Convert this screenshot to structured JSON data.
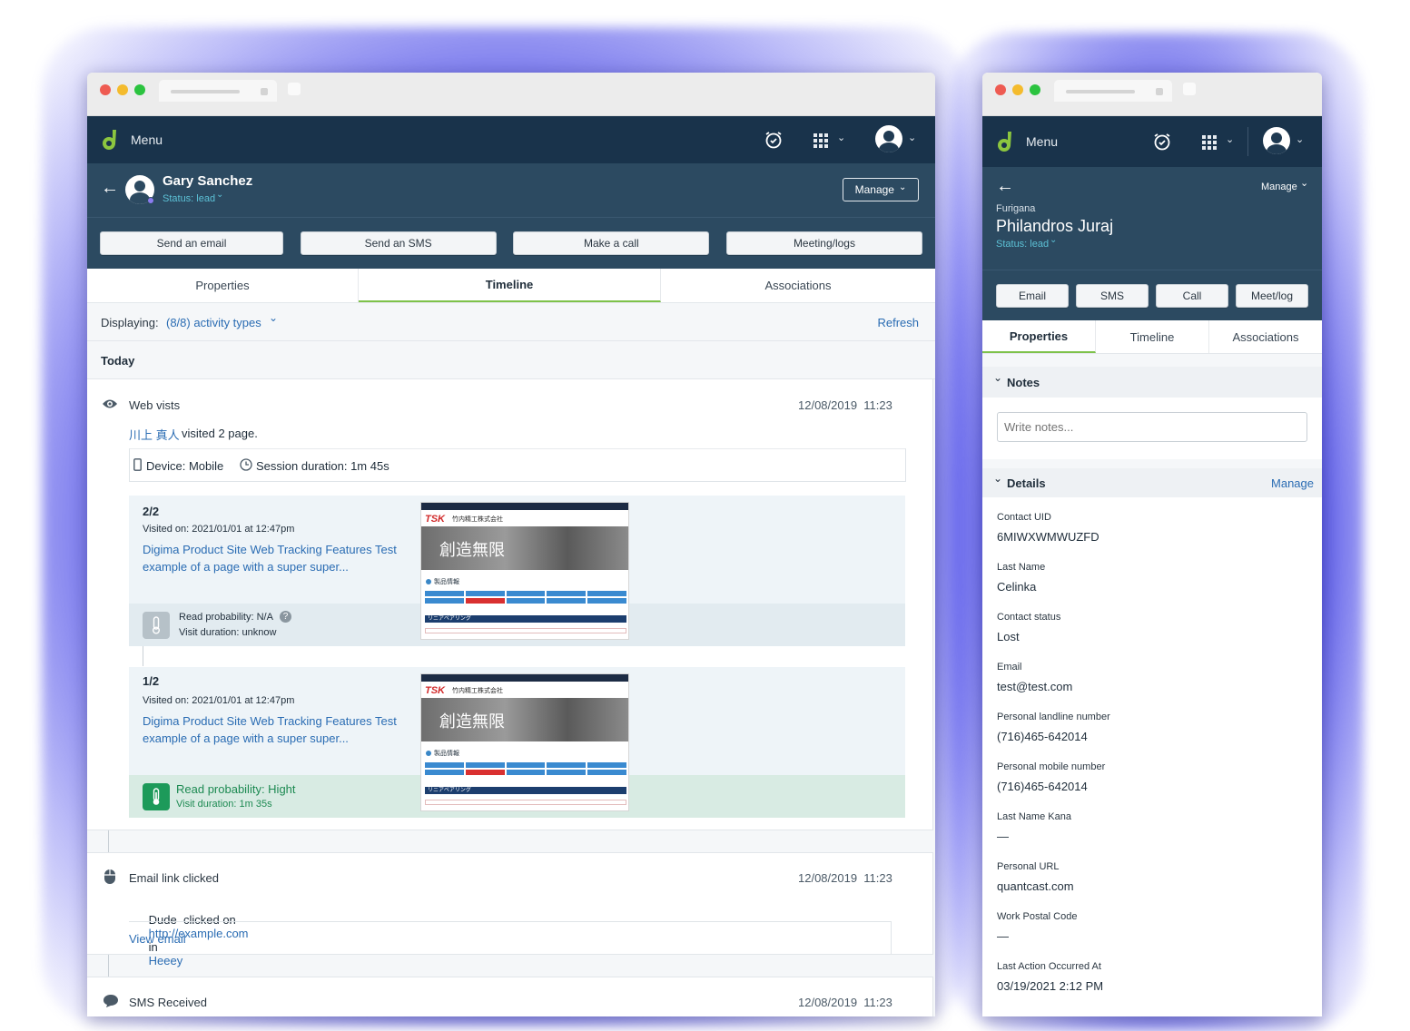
{
  "left_window": {
    "nav": {
      "menu_label": "Menu"
    },
    "contact": {
      "name": "Gary Sanchez",
      "status": "Status: lead",
      "manage_label": "Manage"
    },
    "actions": [
      "Send an email",
      "Send an SMS",
      "Make a call",
      "Meeting/logs"
    ],
    "tabs": [
      "Properties",
      "Timeline",
      "Associations"
    ],
    "active_tab": "Timeline",
    "filter": {
      "displaying_label": "Displaying:",
      "value": "(8/8) activity types",
      "refresh_label": "Refresh"
    },
    "section_today": "Today",
    "web_visits": {
      "title": "Web vists",
      "timestamp": "12/08/2019  11:23",
      "visitor_name": "川上 真人",
      "visitor_text": "visited 2 page.",
      "device": "Device: Mobile",
      "session": "Session duration: 1m 45s",
      "pages": [
        {
          "index": "2/2",
          "visited_on": "Visited on: 2021/01/01 at 12:47pm",
          "title_line1": "Digima Product Site Web Tracking Features Test",
          "title_line2": "example of a page with a super super...",
          "read_probability": "Read probability: N/A",
          "visit_duration": "Visit duration: unknow"
        },
        {
          "index": "1/2",
          "visited_on": "Visited on: 2021/01/01 at 12:47pm",
          "title_line1": "Digima Product Site Web Tracking Features Test",
          "title_line2": "example of a page with a super super...",
          "read_probability": "Read probability: Hight",
          "visit_duration": "Visit duration: 1m 35s"
        }
      ],
      "thumbnail": {
        "brand": "TSK",
        "company": "竹内精工株式会社",
        "banner": "創造無限",
        "section": "製品情報",
        "subsection": "リニアベアリング"
      }
    },
    "email_click": {
      "title": "Email link clicked",
      "timestamp": "12/08/2019  11:23",
      "who": "Dude  clicked on",
      "url": "http://example.com",
      "in_word": "in",
      "campaign": "Heeey",
      "view_label": "View email"
    },
    "sms": {
      "title": "SMS Received",
      "timestamp": "12/08/2019  11:23"
    }
  },
  "right_window": {
    "nav": {
      "menu_label": "Menu"
    },
    "contact": {
      "furigana_label": "Furigana",
      "name": "Philandros Juraj",
      "status": "Status: lead",
      "manage_label": "Manage"
    },
    "actions": [
      "Email",
      "SMS",
      "Call",
      "Meet/log"
    ],
    "tabs": [
      "Properties",
      "Timeline",
      "Associations"
    ],
    "active_tab": "Properties",
    "notes": {
      "title": "Notes",
      "placeholder": "Write notes..."
    },
    "details": {
      "title": "Details",
      "manage_label": "Manage",
      "fields": [
        {
          "label": "Contact UID",
          "value": "6MIWXWMWUZFD"
        },
        {
          "label": "Last Name",
          "value": "Celinka"
        },
        {
          "label": "Contact status",
          "value": "Lost"
        },
        {
          "label": "Email",
          "value": "test@test.com"
        },
        {
          "label": "Personal landline number",
          "value": "(716)465-642014"
        },
        {
          "label": "Personal mobile number",
          "value": "(716)465-642014"
        },
        {
          "label": "Last Name Kana",
          "value": "—"
        },
        {
          "label": "Personal URL",
          "value": "quantcast.com"
        },
        {
          "label": "Work Postal Code",
          "value": "—"
        },
        {
          "label": "Last Action Occurred At",
          "value": "03/19/2021 2:12 PM"
        }
      ]
    }
  },
  "colors": {
    "nav": "#19334b",
    "header": "#2c4a61",
    "accent_green": "#7ec24a",
    "link": "#2a6cb3",
    "glow": "#4c4ce0"
  }
}
